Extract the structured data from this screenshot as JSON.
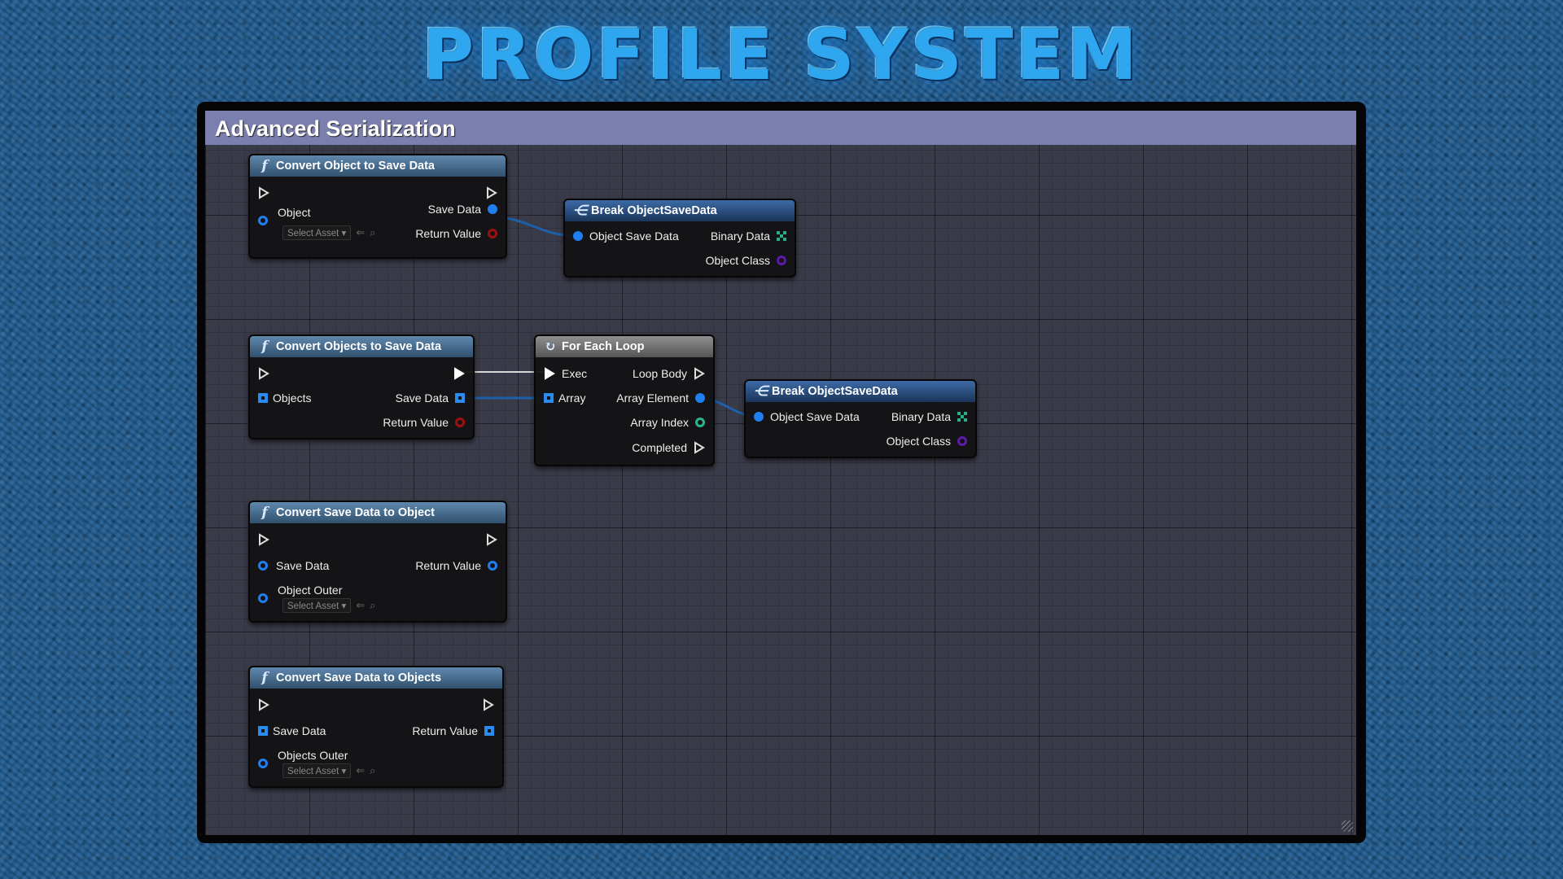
{
  "banner": {
    "title": "PROFILE SYSTEM"
  },
  "comment": {
    "title": "Advanced Serialization"
  },
  "common": {
    "select_asset": "Select Asset ▾",
    "arrow_icon": "use-asset-arrow-icon",
    "browse_icon": "browse-search-icon"
  },
  "nodes": {
    "convert_object": {
      "title": "Convert Object to Save Data",
      "in": {
        "object": "Object"
      },
      "out": {
        "save_data": "Save Data",
        "return_value": "Return Value"
      }
    },
    "break1": {
      "title": "Break ObjectSaveData",
      "in": {
        "object_save_data": "Object Save Data"
      },
      "out": {
        "binary_data": "Binary Data",
        "object_class": "Object Class"
      }
    },
    "convert_objects": {
      "title": "Convert Objects to Save Data",
      "in": {
        "objects": "Objects"
      },
      "out": {
        "save_data": "Save Data",
        "return_value": "Return Value"
      }
    },
    "foreach": {
      "title": "For Each Loop",
      "in": {
        "exec": "Exec",
        "array": "Array"
      },
      "out": {
        "loop_body": "Loop Body",
        "array_element": "Array Element",
        "array_index": "Array Index",
        "completed": "Completed"
      }
    },
    "break2": {
      "title": "Break ObjectSaveData",
      "in": {
        "object_save_data": "Object Save Data"
      },
      "out": {
        "binary_data": "Binary Data",
        "object_class": "Object Class"
      }
    },
    "save_to_object": {
      "title": "Convert Save Data to Object",
      "in": {
        "save_data": "Save Data",
        "object_outer": "Object Outer"
      },
      "out": {
        "return_value": "Return Value"
      }
    },
    "save_to_objects": {
      "title": "Convert Save Data to Objects",
      "in": {
        "save_data": "Save Data",
        "objects_outer": "Objects Outer"
      },
      "out": {
        "return_value": "Return Value"
      }
    }
  },
  "colors": {
    "object_pin": "#1f7ff0",
    "bool_pin": "#a01010",
    "class_pin": "#5e1aa8",
    "int_pin": "#2db48a",
    "comment_bar": "#7b7fae"
  }
}
